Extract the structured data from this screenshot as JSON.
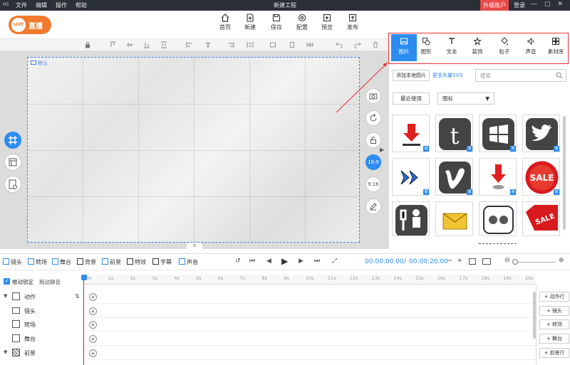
{
  "titlebar": {
    "logo": "H5",
    "menu": [
      "文件",
      "编辑",
      "操作",
      "帮助"
    ],
    "title": "新建工程",
    "upgrade": "升级账户",
    "login": "登录",
    "controls": [
      "—",
      "▢",
      "✕"
    ]
  },
  "live_button": {
    "label": "直播",
    "cam": "LIVE"
  },
  "toolbar": [
    {
      "label": "首页",
      "icon": "home-icon"
    },
    {
      "label": "新建",
      "icon": "new-file-icon"
    },
    {
      "label": "保存",
      "icon": "save-icon"
    },
    {
      "label": "配置",
      "icon": "settings-icon"
    },
    {
      "label": "预览",
      "icon": "preview-icon"
    },
    {
      "label": "发布",
      "icon": "publish-icon"
    }
  ],
  "canvas": {
    "label": "默认"
  },
  "right_buttons": [
    {
      "label": "",
      "icon": "camera-add-icon"
    },
    {
      "label": "",
      "icon": "rotate-icon"
    },
    {
      "label": "",
      "icon": "unlock-icon"
    },
    {
      "label": "16:9",
      "active": true
    },
    {
      "label": "9:16"
    },
    {
      "label": "",
      "icon": "edit-icon"
    }
  ],
  "tabs": [
    {
      "label": "图片",
      "icon": "image-icon",
      "active": true
    },
    {
      "label": "图形",
      "icon": "shape-icon"
    },
    {
      "label": "文本",
      "icon": "text-icon"
    },
    {
      "label": "装饰",
      "icon": "decor-icon"
    },
    {
      "label": "粒子",
      "icon": "particle-icon"
    },
    {
      "label": "声音",
      "icon": "sound-icon"
    },
    {
      "label": "素材库",
      "icon": "library-icon"
    }
  ],
  "panel": {
    "add_local": "添加本地图片",
    "more_svg": "更多矢量SVG",
    "search_placeholder": "搜索",
    "recent": "最近使用",
    "category": "图标",
    "badge": "商"
  },
  "thumbs": [
    "download",
    "tumblr",
    "windows",
    "twitter",
    "forward",
    "vimeo",
    "download-pin",
    "sale-badge",
    "handyman",
    "mail",
    "flickr",
    "sale-tag"
  ],
  "thumb_text": {
    "sale1": "SALE",
    "sale2": "SALE"
  },
  "tl_tools": [
    "镜头",
    "转场",
    "舞台",
    "背景",
    "前景",
    "特效",
    "字幕",
    "声音"
  ],
  "time": {
    "current": "00:00:00.00",
    "total": "00:00:20.00",
    "sep": "/"
  },
  "tl_left": {
    "lock": "推动锁定",
    "mute": "拖动静音"
  },
  "tracks": [
    {
      "label": "动作",
      "icon": "action-icon"
    },
    {
      "label": "镜头",
      "icon": "camera-icon"
    },
    {
      "label": "转场",
      "icon": "transition-icon"
    },
    {
      "label": "舞台",
      "icon": "stage-icon"
    },
    {
      "label": "前景",
      "icon": "foreground-icon"
    }
  ],
  "ruler": [
    "0s",
    "1s",
    "2s",
    "3s",
    "4s",
    "5s",
    "6s",
    "7s",
    "8s",
    "9s",
    "10s",
    "11s",
    "12s",
    "13s",
    "14s",
    "15s",
    "16s",
    "17s",
    "18s",
    "19s",
    "20s"
  ],
  "right_actions": [
    "动作行",
    "镜头",
    "转场",
    "舞台",
    "前景行"
  ],
  "colors": {
    "accent": "#2d8cf0",
    "live": "#f07a2e",
    "upgrade": "#e84a4a",
    "highlight": "#e33"
  }
}
